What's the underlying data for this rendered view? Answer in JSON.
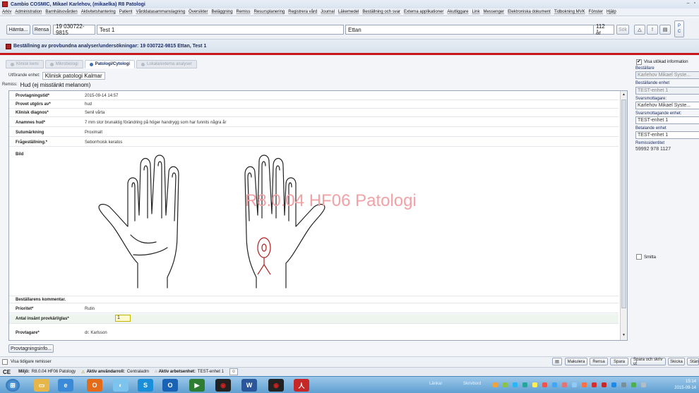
{
  "window": {
    "title": "Cambio COSMIC, Mikael  Karlehov, (mikaelka) R8 Patologi"
  },
  "menu": [
    "Arkiv",
    "Administration",
    "Barnhälsovården",
    "Aktivitetshantering",
    "Patient",
    "Vårddatasammanslagning",
    "Översikter",
    "Beläggning",
    "Remiss",
    "Resursplanering",
    "Registrera vård",
    "Journal",
    "Läkemedel",
    "Beställning och svar",
    "Externa applikationer",
    "Akutliggare",
    "Link",
    "Messenger",
    "Elektroniska dokument",
    "Tidbokning MVK",
    "Fönster",
    "Hjälp"
  ],
  "toolbar": {
    "hamta": "Hämta...",
    "rensa": "Rensa",
    "patient_id": "19 030722-9815",
    "patient_name": "Test 1",
    "unit": "Ettan",
    "age": "112 år",
    "sok": "Sök",
    "badge": "P C"
  },
  "section": {
    "title": "Beställning av provbundna analyser/undersökningar: 19 030722-9815 Ettan, Test 1"
  },
  "tabs": [
    "Klinisk kemi",
    "Mikrobiologi",
    "Patologi/Cytologi",
    "Lokala/externa analyser"
  ],
  "utforande": {
    "label": "Utförande enhet:",
    "value": "Klinisk patologi Kalmar"
  },
  "remiss": {
    "label": "Remiss:",
    "value": "Hud (ej misstänkt melanom)"
  },
  "form": {
    "rows": [
      {
        "label": "Provtagningstid*",
        "value": "2015-09-14 14:57"
      },
      {
        "label": "Provet utgörs av*",
        "value": "hud"
      },
      {
        "label": "Klinisk diagnos*",
        "value": "Senil vårta"
      },
      {
        "label": "Anamnes hud*",
        "value": "7 mm stor brunaktig förändring på höger handrygg som har funnits några år"
      },
      {
        "label": "Sutumärkning",
        "value": "Proximalt"
      },
      {
        "label": "Frågeställning.*",
        "value": "Seborrhoisk keratos"
      },
      {
        "label": "Bild",
        "value": ""
      }
    ],
    "watermark": "R8.0.04 HF06 Patologi",
    "kommentar_label": "Beställarens kommentar.",
    "prioritet_label": "Prioritet*",
    "prioritet_value": "Rutin",
    "antal_label": "Antal insänt provkärl/glas*",
    "antal_value": "1",
    "provtagare_label": "Provtagare*",
    "provtagare_value": "dr. Karlsson"
  },
  "provinfo_button": "Provtagningsinfo...",
  "sidebar": {
    "visa_utokad": "Visa utökad information",
    "bestallare_label": "Beställare",
    "bestallare_value": "Karlehov Mikael Syste...",
    "bestallande_label": "Beställande enhet",
    "bestallande_value": "TEST-enhet 1",
    "svarsmottagare_label": "Svarsmottagare:",
    "svarsmottagare_value": "Karlehov Mikael Syste...",
    "svarsmottagande_label": "Svarsmottagande enhet:",
    "svarsmottagande_value": "TEST-enhet 1",
    "betalande_label": "Betalande enhet",
    "betalande_value": "TEST-enhet 1",
    "remissid_label": "Remissidentitet",
    "remissid_value": "59992 978 1127",
    "smitta": "Smitta"
  },
  "bottom": {
    "visa_tidigare": "Visa tidigare remisser",
    "makulera": "Makulera",
    "rensa": "Rensa",
    "spara": "Spara",
    "spara_skriv": "Spara och skriv ut",
    "skicka": "Skicka",
    "stang": "Stäng"
  },
  "status": {
    "ce": "CE",
    "miljo_label": "Miljö:",
    "miljo_value": "R8.0.04 HF06 Patology",
    "anvandarroll_label": "Aktiv användarroll:",
    "anvandarroll_value": "Centraladm",
    "arbetsenhet_label": "Aktiv arbetsenhet:",
    "arbetsenhet_value": "TEST-enhet 1"
  },
  "taskbar": {
    "lankar": "Länkar",
    "skrivbord": "Skrivbord",
    "time": "15:14",
    "date": "2015-09-14"
  }
}
